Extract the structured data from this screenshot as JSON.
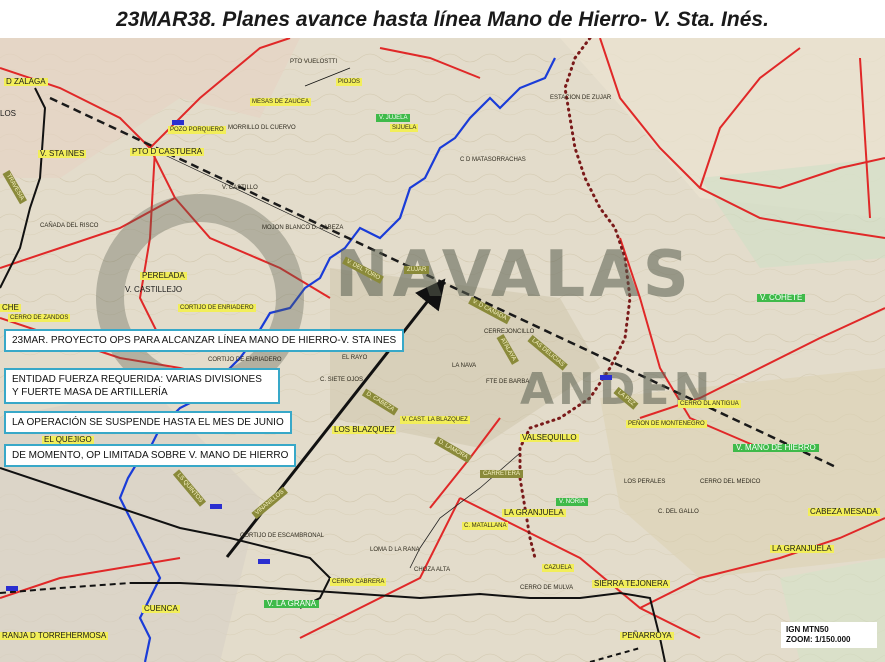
{
  "title": "23MAR38. Planes avance hasta línea Mano de Hierro- V. Sta. Inés.",
  "annotations": [
    "23MAR. PROYECTO OPS PARA ALCANZAR LÍNEA MANO DE HIERRO-V. STA INES",
    "ENTIDAD FUERZA REQUERIDA: VARIAS DIVISIONES",
    "Y FUERTE MASA DE ARTILLERÍA",
    "LA OPERACIÓN SE SUSPENDE HASTA EL MES DE JUNIO",
    "DE MOMENTO, OP LIMITADA SOBRE V. MANO DE HIERRO"
  ],
  "scale": {
    "source": "IGN MTN50",
    "zoom": "ZOOM: 1/150.000"
  },
  "watermark": {
    "line1": "NAVALAS",
    "line2": "ANDEN"
  },
  "places": {
    "zalaga": "D ZALAGA",
    "v_sta_ines": "V. STA INES",
    "pto_castuera": "PTO D CASTUERA",
    "perelada": "PERELADA",
    "v_castillejo": "V. CASTILLEJO",
    "cheche": "CHE",
    "los_blazquez": "LOS BLAZQUEZ",
    "el_quejigo": "EL QUEJIGO",
    "valsequillo": "VALSEQUILLO",
    "v_mano_hierro": "V. MANO DE HIERRO",
    "v_cohete": "V. COHETE",
    "cabeza_mesada": "CABEZA MESADA",
    "la_granjuela": "LA GRANJUELA",
    "la_granjuela2": "LA GRANJUELA",
    "v_la_grana": "V. LA GRANA",
    "cuenca": "CUENCA",
    "granja_torrehermosa": "RANJA D TORREHERMOSA",
    "penarroya": "PEÑARROYA",
    "sierra_tejonera": "SIERRA TEJONERA",
    "v_noria": "V. NORIA",
    "los": "LOS"
  },
  "small_labels": [
    "PTO VUELOSTTI",
    "PIOJOS",
    "MESAS DE ZAUCEA",
    "POZO PORQUERO",
    "MORRILLO DL CUERVO",
    "V. JUJELA",
    "SIJUELA",
    "C D MATASORRACHAS",
    "ESTACION DE ZUJAR",
    "V. CASTILLO",
    "CAÑADA DEL RISCO",
    "MOJON BLANCO D. CABEZA",
    "CORTIJO DE ENRIADERO",
    "CERRO DE ZANDOS",
    "CORTIJO DE ENRIADERO",
    "CERREJONCILLO",
    "FTE DE BARBA",
    "LA NAVA",
    "EL RAYO",
    "C. SIETE OJOS",
    "V. CAST. LA BLAZQUEZ",
    "CERRO DL ANTIGUA",
    "PEÑON DE MONTENEGRO",
    "LOS PERALES",
    "CERRO DEL MEDICO",
    "C. MATALLANA",
    "LOMA D LA RANA",
    "CHOZA ALTA",
    "CERRO DE MULVA",
    "CAZUELA",
    "CORTIJO DE ESCAMBRONAL",
    "C. DEL GALLO",
    "CERRO CABRERA"
  ],
  "road_labels": {
    "r1": "V. DEL TORO",
    "r2": "V. D CAÑADA",
    "r3": "LAS DELICIAS",
    "r4": "ZUJAR",
    "r5": "LA PEZ",
    "r6": "CARRETERA",
    "r7": "D. LAMORA",
    "r8": "D. CABEZA",
    "r9": "VINANILLOS",
    "r10": "LS QUINTOS",
    "r11": "ATALAYA",
    "r12": "TRAVESIA"
  },
  "colors": {
    "map_bg": "#e3dccb",
    "river": "#1a3cd8",
    "roads": "#e02828",
    "rail": "#111111",
    "front_line": "#1a1a1a",
    "arrow": "#111111",
    "box_border": "#38a8c8",
    "highlight": "#f2ee5a",
    "green_label": "#3fba4a"
  }
}
